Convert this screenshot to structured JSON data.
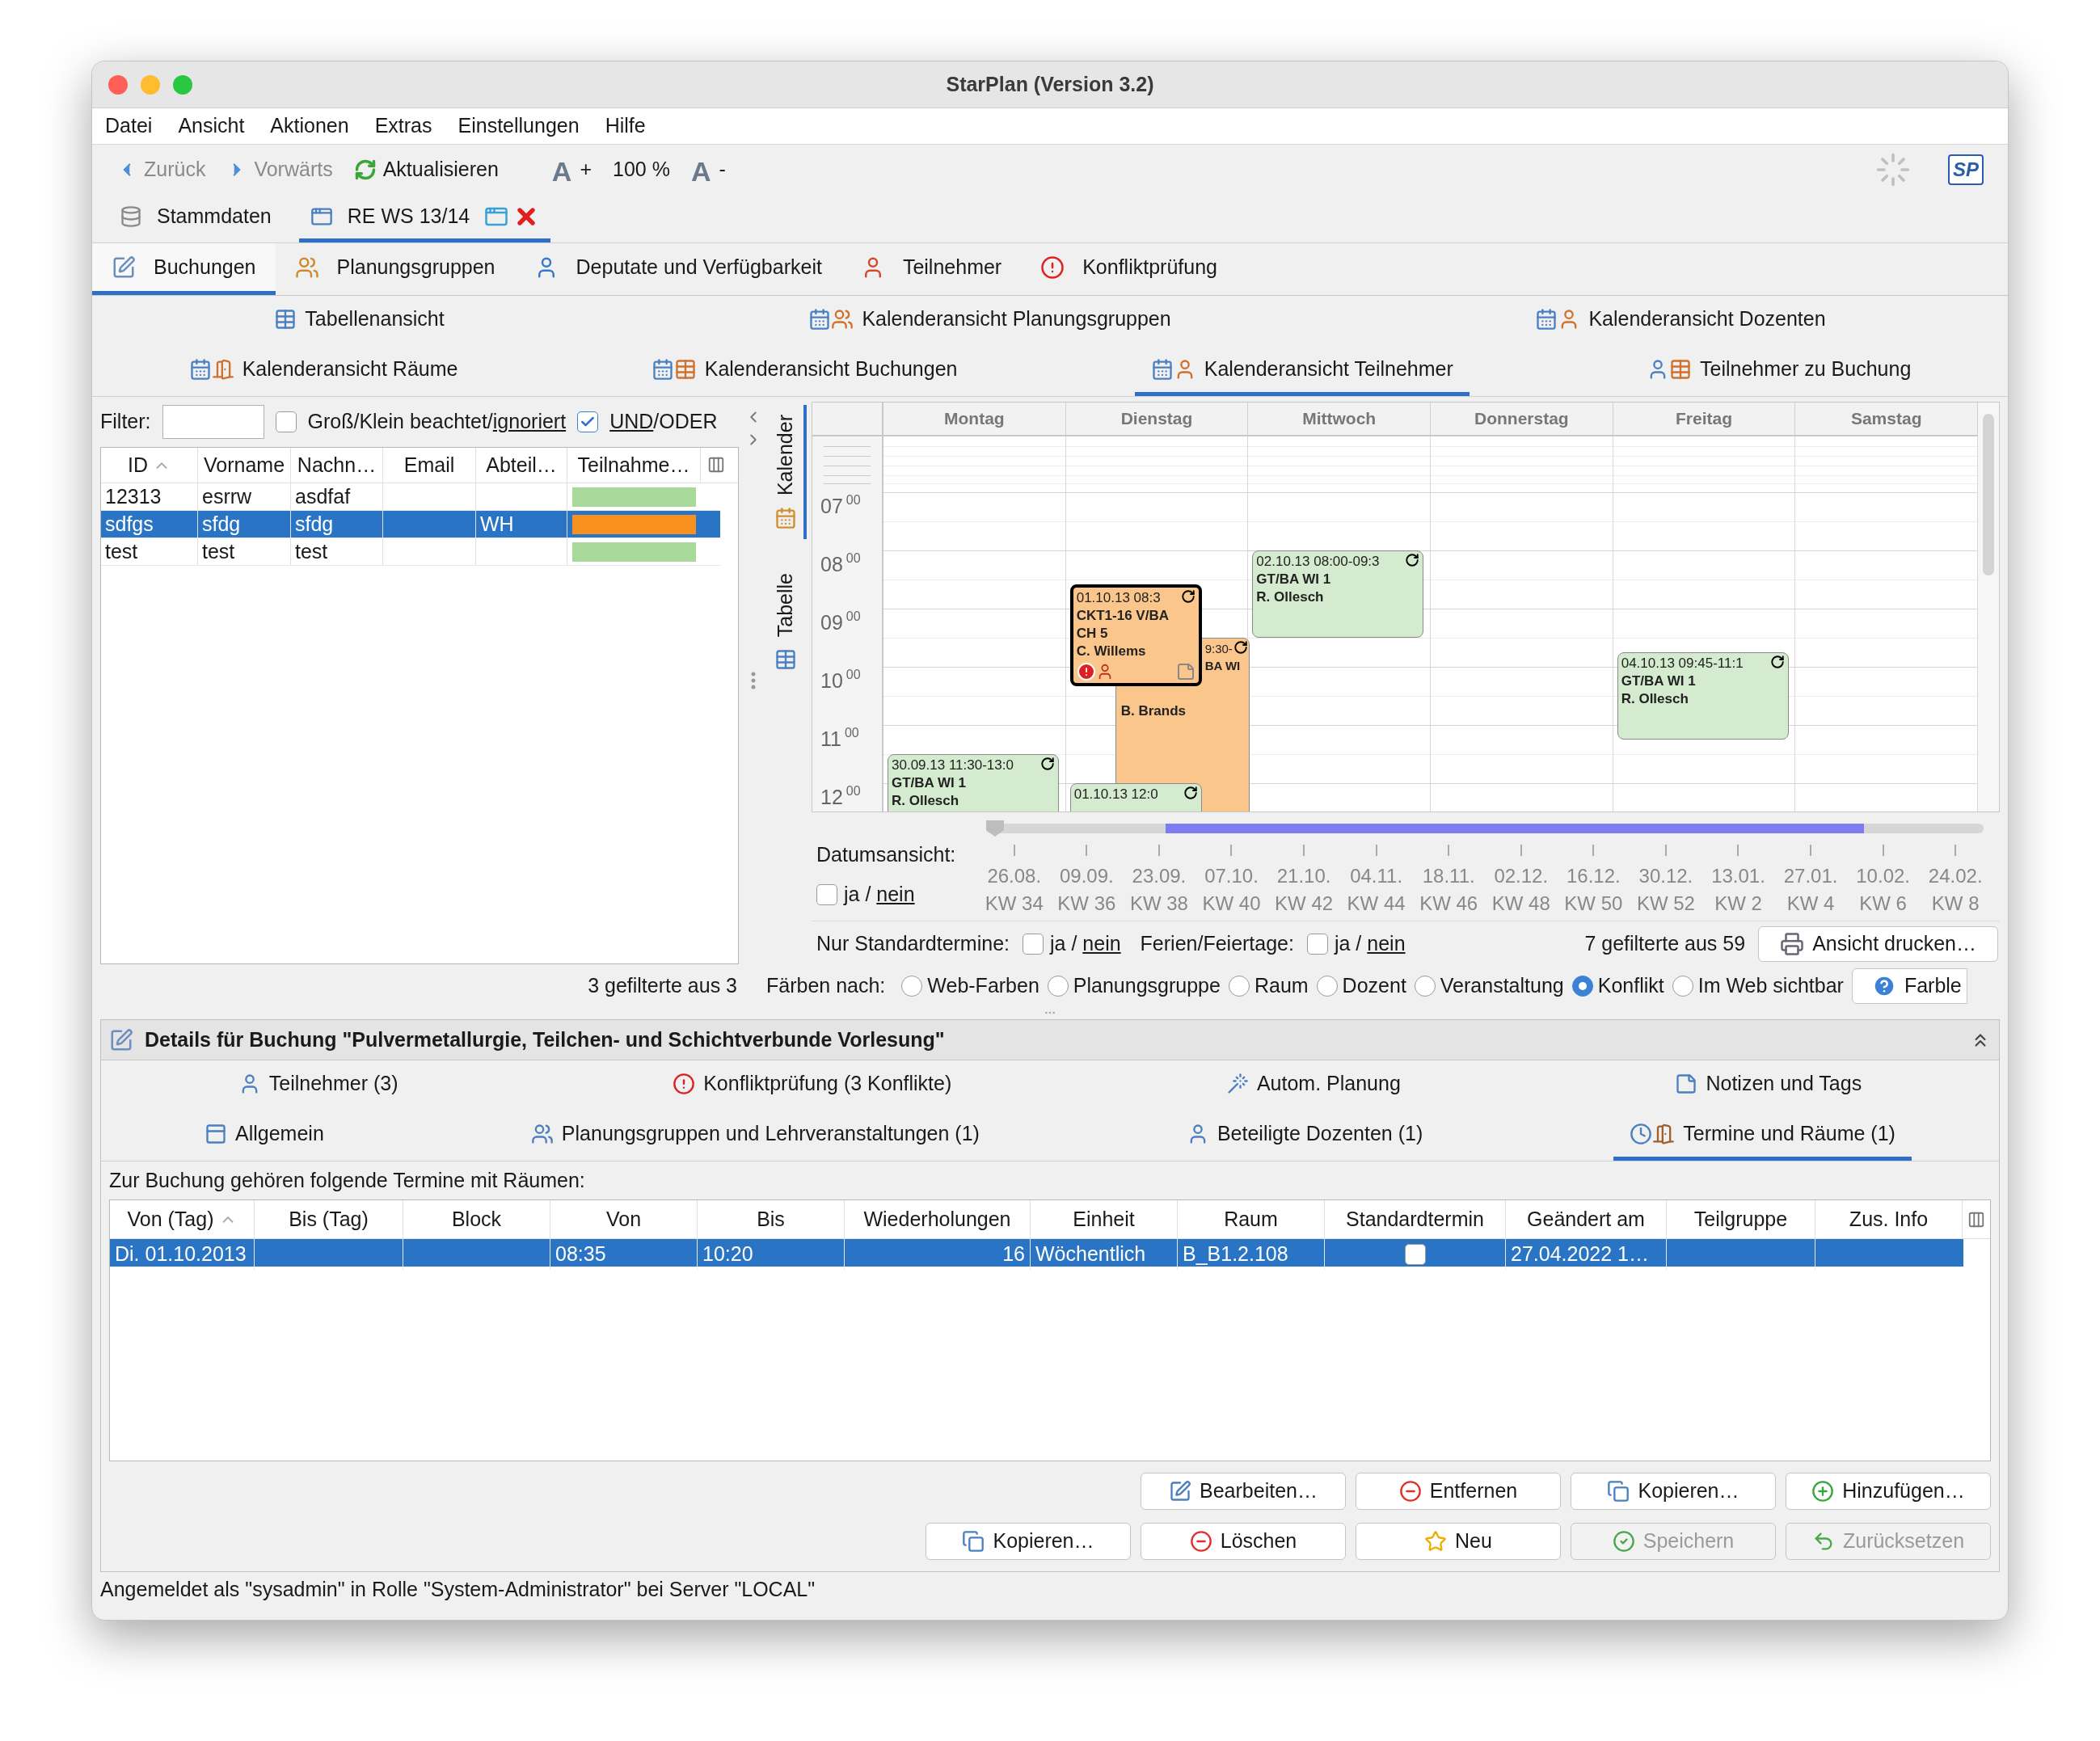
{
  "window": {
    "title": "StarPlan (Version 3.2)"
  },
  "menu": [
    "Datei",
    "Ansicht",
    "Aktionen",
    "Extras",
    "Einstellungen",
    "Hilfe"
  ],
  "toolbar": {
    "back": {
      "label": "Zurück",
      "disabled": true
    },
    "forward": {
      "label": "Vorwärts",
      "disabled": true
    },
    "refresh": {
      "label": "Aktualisieren"
    },
    "zoom_in": {
      "glyph": "A",
      "label": "+"
    },
    "zoom_level": "100 %",
    "zoom_out": {
      "glyph": "A",
      "label": "-"
    },
    "logo": "SP"
  },
  "doc_tabs": [
    {
      "label": "Stammdaten",
      "selected": false,
      "closable": false
    },
    {
      "label": "RE WS 13/14",
      "selected": true,
      "closable": true
    }
  ],
  "main_tabs": [
    {
      "label": "Buchungen",
      "selected": true
    },
    {
      "label": "Planungsgruppen",
      "selected": false
    },
    {
      "label": "Deputate und Verfügbarkeit",
      "selected": false
    },
    {
      "label": "Teilnehmer",
      "selected": false
    },
    {
      "label": "Konfliktprüfung",
      "selected": false
    }
  ],
  "view_tab_rows": [
    [
      {
        "label": "Tabellenansicht",
        "selected": false
      },
      {
        "label": "Kalenderansicht Planungsgruppen",
        "selected": false
      },
      {
        "label": "Kalenderansicht Dozenten",
        "selected": false
      }
    ],
    [
      {
        "label": "Kalenderansicht Räume",
        "selected": false
      },
      {
        "label": "Kalenderansicht Buchungen",
        "selected": false
      },
      {
        "label": "Kalenderansicht Teilnehmer",
        "selected": true
      },
      {
        "label": "Teilnehmer zu Buchung",
        "selected": false
      }
    ]
  ],
  "filter": {
    "label": "Filter:",
    "case_option": {
      "label": "Groß/Klein beachtet/",
      "link": "ignoriert",
      "checked": false
    },
    "and_or": {
      "link": "UND",
      "label": "/ODER",
      "checked": true
    }
  },
  "participants": {
    "columns": [
      {
        "label": "ID",
        "sorted": true
      },
      {
        "label": "Vorname",
        "sorted": false
      },
      {
        "label": "Nachn…",
        "sorted": false
      },
      {
        "label": "Email",
        "sorted": false
      },
      {
        "label": "Abteil…",
        "sorted": false
      },
      {
        "label": "Teilnahme…",
        "sorted": false
      }
    ],
    "rows": [
      {
        "id": "12313",
        "first_name": "esrrw",
        "last_name": "asdfaf",
        "color": "#a8d99a",
        "selected": false
      },
      {
        "id": "sdfgs",
        "first_name": "sfdg",
        "last_name": "sfdg",
        "department": "WH",
        "color": "#f7901e",
        "selected": true
      },
      {
        "id": "test",
        "first_name": "test",
        "last_name": "test",
        "color": "#a8d99a",
        "selected": false
      }
    ],
    "count": "3 gefilterte aus 3"
  },
  "side_tabs": [
    {
      "label": "Kalender",
      "selected": true
    },
    {
      "label": "Tabelle",
      "selected": false
    }
  ],
  "calendar": {
    "hours": [
      {
        "hour": "07",
        "minutes": "00"
      },
      {
        "hour": "08",
        "minutes": "00"
      },
      {
        "hour": "09",
        "minutes": "00"
      },
      {
        "hour": "10",
        "minutes": "00"
      },
      {
        "hour": "11",
        "minutes": "00"
      },
      {
        "hour": "12",
        "minutes": "00"
      }
    ],
    "days": [
      {
        "name": "Montag",
        "events": [
          {
            "kind": "block",
            "time": "30.09.13 11:30-13:0",
            "lines": [
              "GT/BA WI 1",
              "R. Ollesch"
            ],
            "color": "#d4ebcf",
            "selected": false,
            "conflict": false
          }
        ]
      },
      {
        "name": "Dienstag",
        "events": [
          {
            "kind": "block",
            "time": "01.10.13 08:3",
            "lines": [
              "CKT1-16 V/BA",
              "CH 5",
              "C. Willems"
            ],
            "color": "#fbc68c",
            "selected": true,
            "conflict": true
          },
          {
            "kind": "partly_hidden",
            "time": "9:30-",
            "lines": [
              "BA WI",
              "B. Brands"
            ],
            "color": "#fbc68c",
            "selected": false,
            "conflict": false
          },
          {
            "kind": "block",
            "time": "01.10.13 12:0",
            "color": "#d4ebcf",
            "selected": false,
            "conflict": false
          }
        ]
      },
      {
        "name": "Mittwoch",
        "events": [
          {
            "kind": "block",
            "time": "02.10.13 08:00-09:3",
            "lines": [
              "GT/BA WI 1",
              "R. Ollesch"
            ],
            "color": "#d4ebcf",
            "selected": false,
            "conflict": false
          }
        ]
      },
      {
        "name": "Donnerstag"
      },
      {
        "name": "Freitag",
        "events": [
          {
            "kind": "block",
            "time": "04.10.13 09:45-11:1",
            "lines": [
              "GT/BA WI 1",
              "R. Ollesch"
            ],
            "color": "#d4ebcf",
            "selected": false,
            "conflict": false
          }
        ]
      },
      {
        "name": "Samstag"
      }
    ]
  },
  "date_view": {
    "label": "Datumsansicht:",
    "slider": {
      "level": 0
    },
    "toggle": {
      "label": "ja /",
      "link": "nein",
      "checked": false
    },
    "ticks": [
      {
        "date": "26.08.",
        "week": "KW 34"
      },
      {
        "date": "09.09.",
        "week": "KW 36"
      },
      {
        "date": "23.09.",
        "week": "KW 38"
      },
      {
        "date": "07.10.",
        "week": "KW 40"
      },
      {
        "date": "21.10.",
        "week": "KW 42"
      },
      {
        "date": "04.11.",
        "week": "KW 44"
      },
      {
        "date": "18.11.",
        "week": "KW 46"
      },
      {
        "date": "02.12.",
        "week": "KW 48"
      },
      {
        "date": "16.12.",
        "week": "KW 50"
      },
      {
        "date": "30.12.",
        "week": "KW 52"
      },
      {
        "date": "13.01.",
        "week": "KW 2"
      },
      {
        "date": "27.01.",
        "week": "KW 4"
      },
      {
        "date": "10.02.",
        "week": "KW 6"
      },
      {
        "date": "24.02.",
        "week": "KW 8"
      }
    ]
  },
  "options_row": {
    "standard": {
      "label": "Nur Standardtermine:",
      "toggle": {
        "label": "ja /",
        "link": "nein",
        "checked": false
      }
    },
    "holidays": {
      "label": "Ferien/Feiertage:",
      "toggle": {
        "label": "ja /",
        "link": "nein",
        "checked": false
      }
    },
    "count": "7 gefilterte aus 59",
    "print_button": "Ansicht drucken…"
  },
  "color_by": {
    "label": "Färben nach:",
    "options": [
      {
        "label": "Web-Farben",
        "selected": false
      },
      {
        "label": "Planungsgruppe",
        "selected": false
      },
      {
        "label": "Raum",
        "selected": false
      },
      {
        "label": "Dozent",
        "selected": false
      },
      {
        "label": "Veranstaltung",
        "selected": false
      },
      {
        "label": "Konflikt",
        "selected": true
      },
      {
        "label": "Im Web sichtbar",
        "selected": false
      }
    ],
    "legend_button": "Farble"
  },
  "details": {
    "title": "Details für Buchung \"Pulvermetallurgie, Teilchen- und Schichtverbunde Vorlesung\"",
    "expanded": true,
    "tab_rows": [
      [
        {
          "label": "Teilnehmer (3)",
          "selected": false
        },
        {
          "label": "Konfliktprüfung (3 Konflikte)",
          "selected": false
        },
        {
          "label": "Autom. Planung",
          "selected": false
        },
        {
          "label": "Notizen und Tags",
          "selected": false
        }
      ],
      [
        {
          "label": "Allgemein",
          "selected": false
        },
        {
          "label": "Planungsgruppen und Lehrveranstaltungen (1)",
          "selected": false
        },
        {
          "label": "Beteiligte Dozenten (1)",
          "selected": false
        },
        {
          "label": "Termine und Räume (1)",
          "selected": true
        }
      ]
    ],
    "caption": "Zur Buchung gehören folgende Termine mit Räumen:",
    "table": {
      "columns": [
        {
          "label": "Von (Tag)",
          "sorted": true
        },
        {
          "label": "Bis (Tag)",
          "sorted": false
        },
        {
          "label": "Block",
          "sorted": false
        },
        {
          "label": "Von",
          "sorted": false
        },
        {
          "label": "Bis",
          "sorted": false
        },
        {
          "label": "Wiederholungen",
          "sorted": false
        },
        {
          "label": "Einheit",
          "sorted": false
        },
        {
          "label": "Raum",
          "sorted": false
        },
        {
          "label": "Standardtermin",
          "sorted": false
        },
        {
          "label": "Geändert am",
          "sorted": false
        },
        {
          "label": "Teilgruppe",
          "sorted": false
        },
        {
          "label": "Zus. Info",
          "sorted": false
        }
      ],
      "rows": [
        {
          "selected": true,
          "from_day": "Di. 01.10.2013",
          "from": "08:35",
          "to": "10:20",
          "repeats": "16",
          "unit": "Wöchentlich",
          "room": "B_B1.2.108",
          "standard": false,
          "changed": "27.04.2022 1…"
        }
      ]
    },
    "button_rows": [
      [
        {
          "label": "Bearbeiten…",
          "disabled": false
        },
        {
          "label": "Entfernen",
          "disabled": false
        },
        {
          "label": "Kopieren…",
          "disabled": false
        },
        {
          "label": "Hinzufügen…",
          "disabled": false
        }
      ],
      [
        {
          "label": "Kopieren…",
          "disabled": false
        },
        {
          "label": "Löschen",
          "disabled": false
        },
        {
          "label": "Neu",
          "disabled": false
        },
        {
          "label": "Speichern",
          "disabled": true
        },
        {
          "label": "Zurücksetzen",
          "disabled": true
        }
      ]
    ]
  },
  "status_bar": "Angemeldet als \"sysadmin\" in Rolle \"System-Administrator\" bei Server \"LOCAL\""
}
